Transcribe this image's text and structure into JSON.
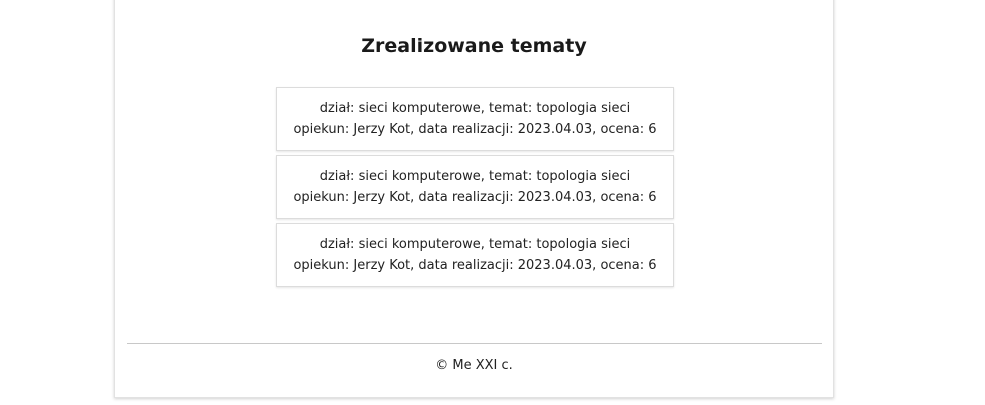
{
  "main": {
    "title": "Zrealizowane tematy",
    "topics": [
      {
        "line1": "dział: sieci komputerowe, temat: topologia sieci",
        "line2": "opiekun: Jerzy Kot, data realizacji: 2023.04.03, ocena: 6"
      },
      {
        "line1": "dział: sieci komputerowe, temat: topologia sieci",
        "line2": "opiekun: Jerzy Kot, data realizacji: 2023.04.03, ocena: 6"
      },
      {
        "line1": "dział: sieci komputerowe, temat: topologia sieci",
        "line2": "opiekun: Jerzy Kot, data realizacji: 2023.04.03, ocena: 6"
      }
    ]
  },
  "footer": {
    "text": "© Me XXI c."
  }
}
